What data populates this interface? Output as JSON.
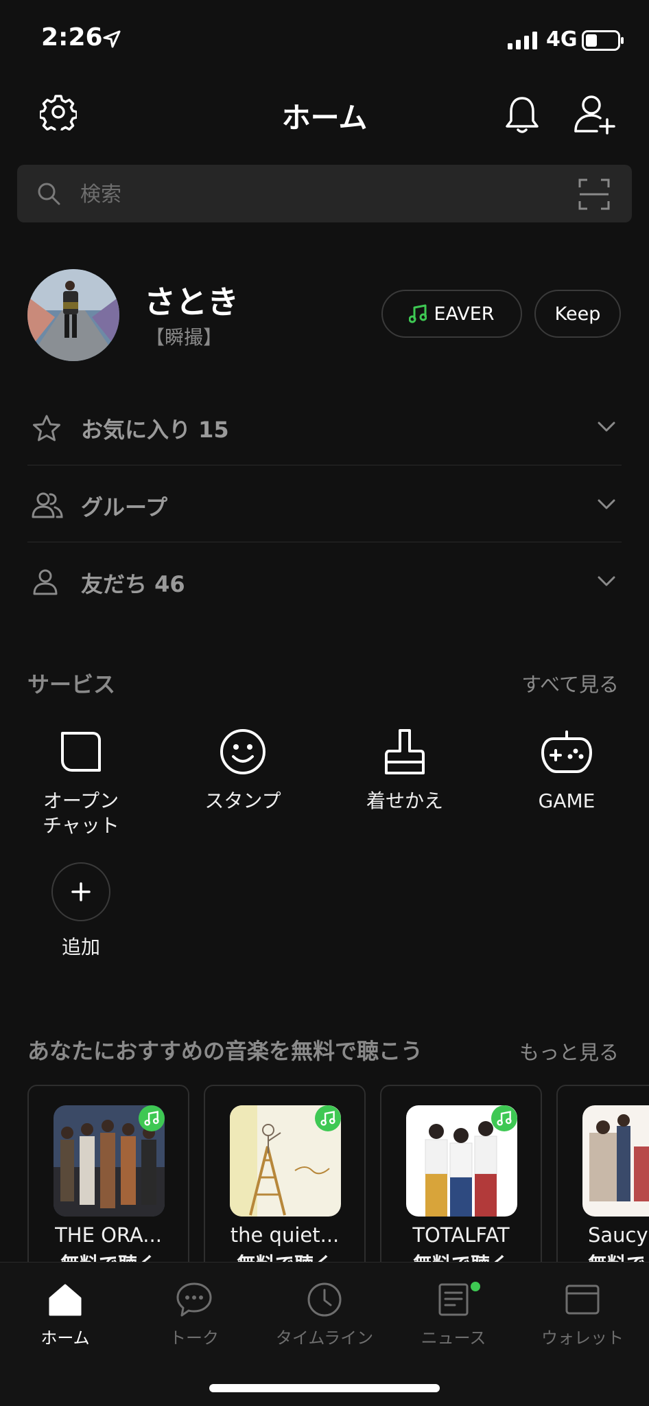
{
  "status": {
    "time": "2:26",
    "network": "4G"
  },
  "header": {
    "title": "ホーム"
  },
  "search": {
    "placeholder": "検索"
  },
  "profile": {
    "name": "さとき",
    "status": "【瞬撮】",
    "music_label": "EAVER",
    "keep_label": "Keep"
  },
  "friends": {
    "favorites": "お気に入り 15",
    "groups": "グループ",
    "friends": "友だち 46"
  },
  "services": {
    "title": "サービス",
    "see_all": "すべて見る",
    "items": [
      {
        "label": "オープン\nチャット",
        "icon": "open-chat-icon"
      },
      {
        "label": "スタンプ",
        "icon": "sticker-icon"
      },
      {
        "label": "着せかえ",
        "icon": "theme-icon"
      },
      {
        "label": "GAME",
        "icon": "game-icon"
      }
    ],
    "add_label": "追加"
  },
  "music": {
    "title": "あなたにおすすめの音楽を無料で聴こう",
    "see_more": "もっと見る",
    "cards": [
      {
        "title": "THE ORA...",
        "sub": "無料で聴く"
      },
      {
        "title": "the quiet...",
        "sub": "無料で聴く"
      },
      {
        "title": "TOTALFAT",
        "sub": "無料で聴く"
      },
      {
        "title": "Saucy",
        "sub": "無料で"
      }
    ]
  },
  "tabs": [
    {
      "label": "ホーム",
      "icon": "home-icon",
      "active": true
    },
    {
      "label": "トーク",
      "icon": "chat-icon"
    },
    {
      "label": "タイムライン",
      "icon": "clock-icon"
    },
    {
      "label": "ニュース",
      "icon": "news-icon"
    },
    {
      "label": "ウォレット",
      "icon": "wallet-icon"
    }
  ],
  "colors": {
    "background": "#111111",
    "accent_green": "#3ec853",
    "muted_text": "#8a8a8a"
  }
}
